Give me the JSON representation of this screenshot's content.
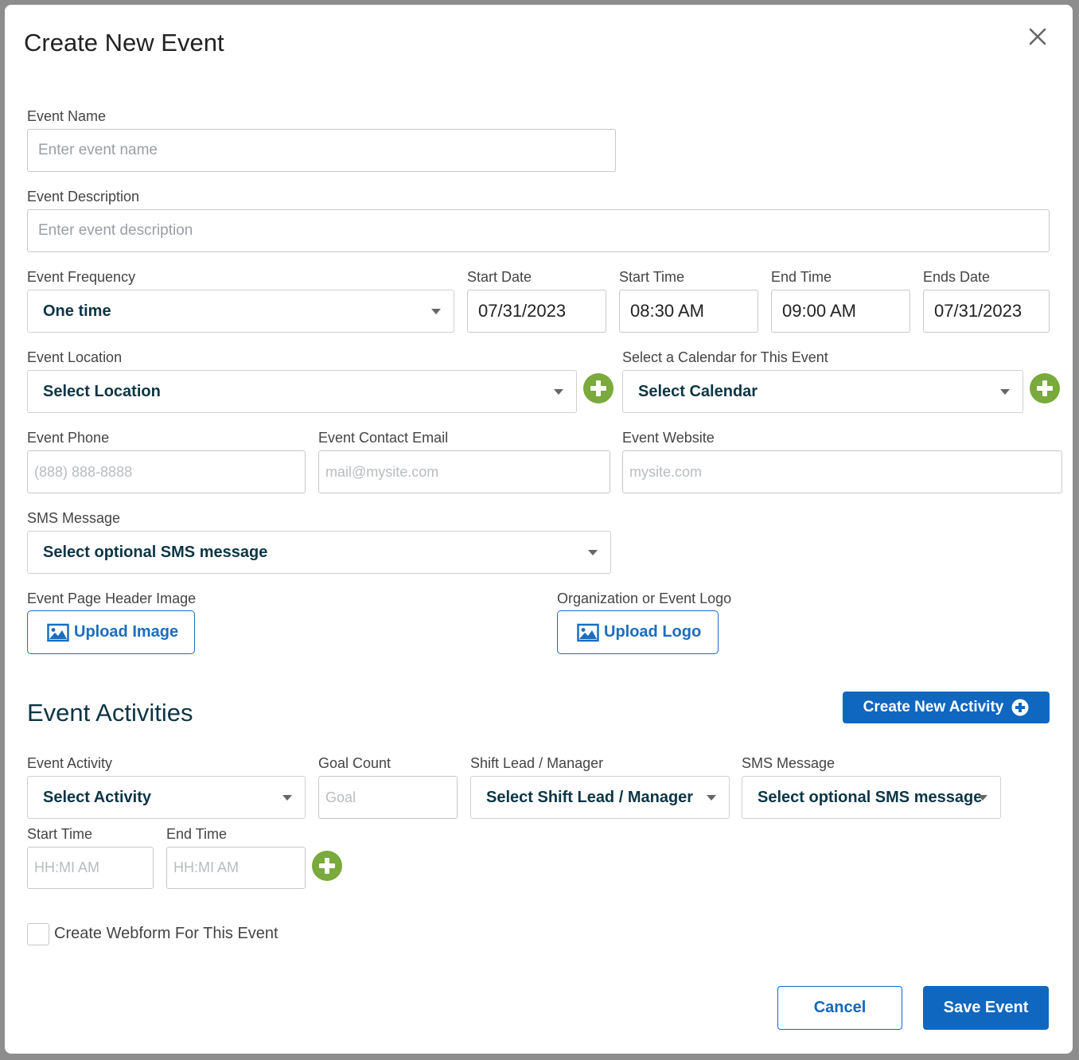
{
  "modal": {
    "title": "Create New Event"
  },
  "form": {
    "event_name": {
      "label": "Event Name",
      "placeholder": "Enter event name"
    },
    "event_description": {
      "label": "Event Description",
      "placeholder": "Enter event description"
    },
    "event_frequency": {
      "label": "Event Frequency",
      "value": "One time"
    },
    "start_date": {
      "label": "Start Date",
      "value": "07/31/2023"
    },
    "start_time": {
      "label": "Start Time",
      "value": "08:30 AM"
    },
    "end_time": {
      "label": "End Time",
      "value": "09:00 AM"
    },
    "ends_date": {
      "label": "Ends Date",
      "value": "07/31/2023"
    },
    "event_location": {
      "label": "Event Location",
      "value": "Select Location"
    },
    "calendar": {
      "label": "Select a Calendar for This Event",
      "value": "Select Calendar"
    },
    "event_phone": {
      "label": "Event Phone",
      "placeholder": "(888) 888-8888"
    },
    "event_email": {
      "label": "Event Contact Email",
      "placeholder": "mail@mysite.com"
    },
    "event_website": {
      "label": "Event Website",
      "placeholder": "mysite.com"
    },
    "sms_message": {
      "label": "SMS Message",
      "value": "Select optional SMS message"
    },
    "header_image": {
      "label": "Event Page Header Image",
      "button": "Upload Image"
    },
    "logo": {
      "label": "Organization or Event Logo",
      "button": "Upload Logo"
    }
  },
  "activities": {
    "title": "Event Activities",
    "create_button": "Create New Activity",
    "event_activity": {
      "label": "Event Activity",
      "value": "Select Activity"
    },
    "goal_count": {
      "label": "Goal Count",
      "placeholder": "Goal"
    },
    "shift_lead": {
      "label": "Shift Lead / Manager",
      "value": "Select Shift Lead / Manager"
    },
    "sms_message": {
      "label": "SMS Message",
      "value": "Select optional SMS message"
    },
    "start_time": {
      "label": "Start Time",
      "placeholder": "HH:MI AM"
    },
    "end_time": {
      "label": "End Time",
      "placeholder": "HH:MI AM"
    }
  },
  "webform": {
    "label": "Create Webform For This Event",
    "checked": false
  },
  "footer": {
    "cancel": "Cancel",
    "save": "Save Event"
  },
  "colors": {
    "primary": "#1067c0",
    "add_green": "#7aa93c",
    "select_text": "#0c3545"
  }
}
